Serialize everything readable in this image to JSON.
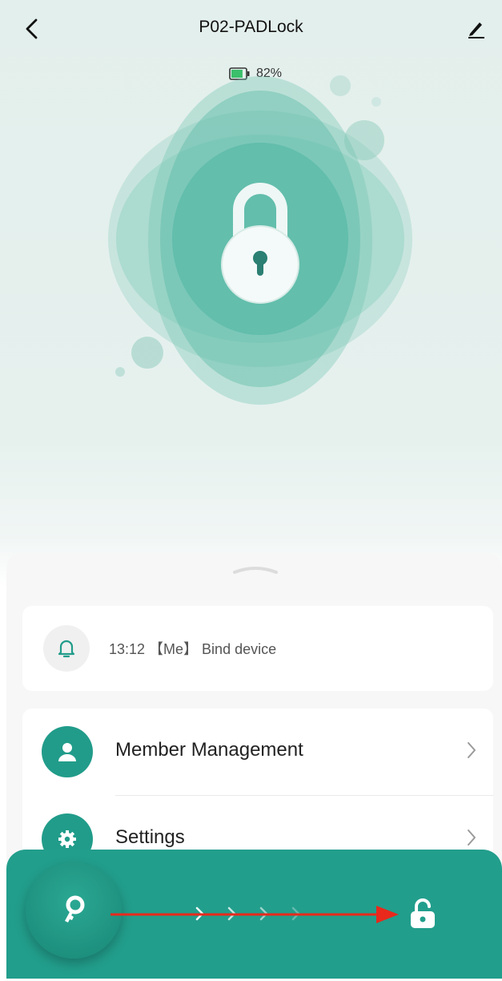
{
  "header": {
    "title": "P02-PADLock",
    "back_icon": "chevron-left-icon",
    "edit_icon": "pencil-icon"
  },
  "battery": {
    "level_text": "82%",
    "level": 82,
    "color": "#3bbf6b"
  },
  "lock_status_icon": "padlock-locked-icon",
  "log": {
    "icon": "bell-icon",
    "text": "13:12 【Me】 Bind device"
  },
  "menu": {
    "items": [
      {
        "label": "Member Management",
        "icon": "user-icon"
      },
      {
        "label": "Settings",
        "icon": "gear-icon"
      }
    ]
  },
  "unlock_slider": {
    "knob_icon": "key-icon",
    "target_icon": "padlock-open-icon"
  },
  "colors": {
    "accent": "#219c8a",
    "header_bg": "#e3efec",
    "annotation_arrow": "#e8291c"
  }
}
